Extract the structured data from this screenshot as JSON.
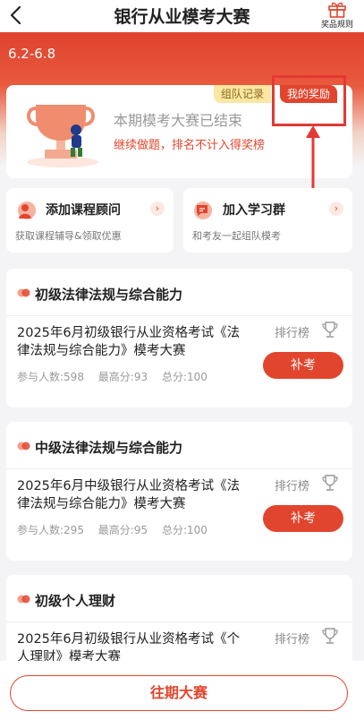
{
  "header": {
    "title": "银行从业模考大赛",
    "rules_label": "奖品规则"
  },
  "banner": {
    "date_range": "6.2-6.8"
  },
  "status": {
    "ended": "本期模考大赛已结束",
    "note": "继续做题，排名不计入得奖榜",
    "team_record": "组队记录",
    "my_rewards": "我的奖励"
  },
  "quick": [
    {
      "title": "添加课程顾问",
      "sub": "获取课程辅导&领取优惠"
    },
    {
      "title": "加入学习群",
      "sub": "和考友一起组队模考"
    }
  ],
  "exams": [
    {
      "category": "初级法律法规与综合能力",
      "title": "2025年6月初级银行从业资格考试《法律法规与综合能力》模考大赛",
      "participants": "参与人数:598",
      "max_score": "最高分:93",
      "total": "总分:100",
      "rank_label": "排行榜",
      "button": "补考"
    },
    {
      "category": "中级法律法规与综合能力",
      "title": "2025年6月中级银行从业资格考试《法律法规与综合能力》模考大赛",
      "participants": "参与人数:295",
      "max_score": "最高分:95",
      "total": "总分:100",
      "rank_label": "排行榜",
      "button": "补考"
    },
    {
      "category": "初级个人理财",
      "title": "2025年6月初级银行从业资格考试《个人理财》模考大赛",
      "rank_label": "排行榜"
    }
  ],
  "footer": {
    "past_button": "往期大赛"
  },
  "colors": {
    "accent": "#e2452e",
    "annotation": "#e53935"
  }
}
